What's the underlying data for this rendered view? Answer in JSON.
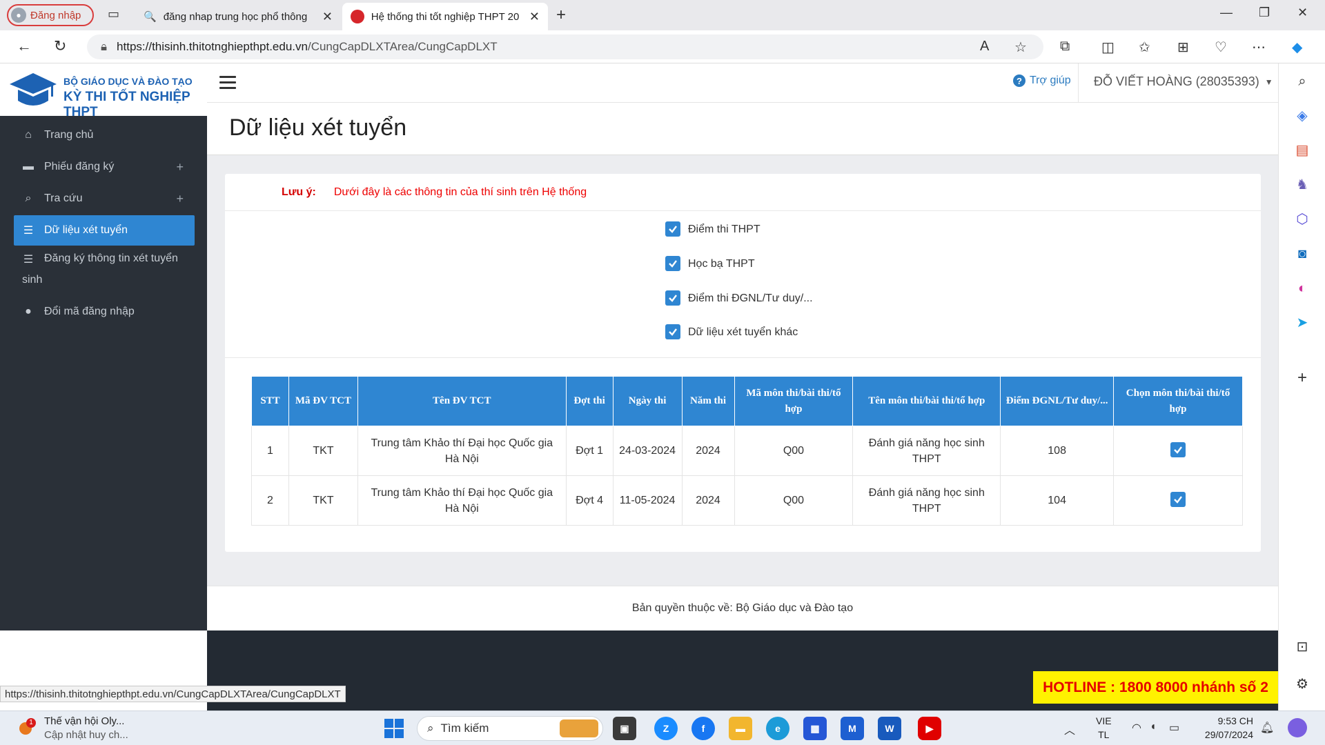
{
  "browser": {
    "profile_label": "Đăng nhập",
    "tabs": [
      {
        "title": "đăng nhap trung học phổ thông"
      },
      {
        "title": "Hệ thống thi tốt nghiệp THPT 20"
      }
    ],
    "url_host": "https://thisinh.thitotnghiepthpt.edu.vn",
    "url_path": "/CungCapDLXTArea/CungCapDLXT",
    "status_url": "https://thisinh.thitotnghiepthpt.edu.vn/CungCapDLXTArea/CungCapDLXT"
  },
  "header": {
    "logo_line1": "BỘ GIÁO DỤC VÀ ĐÀO TẠO",
    "logo_line2": "KỲ THI TỐT NGHIỆP THPT",
    "help_label": "Trợ giúp",
    "user_label": "ĐỖ VIẾT HOÀNG (28035393)"
  },
  "sidebar": {
    "items": [
      {
        "label": "Trang chủ",
        "icon": "home-icon"
      },
      {
        "label": "Phiếu đăng ký",
        "icon": "folder-icon"
      },
      {
        "label": "Tra cứu",
        "icon": "search-icon"
      },
      {
        "label": "Dữ liệu xét tuyển",
        "icon": "list-icon"
      },
      {
        "label": "Đăng ký thông tin xét tuyển",
        "label2": "sinh",
        "icon": "list-icon"
      },
      {
        "label": "Đổi mã đăng nhập",
        "icon": "user-icon"
      }
    ]
  },
  "main": {
    "title": "Dữ liệu xét tuyển",
    "note_label": "Lưu ý:",
    "note_text": "Dưới đây là các thông tin của thí sinh trên Hệ thống",
    "checkboxes": [
      {
        "label": "Điểm thi THPT",
        "checked": true
      },
      {
        "label": "Học bạ THPT",
        "checked": true
      },
      {
        "label": "Điểm thi ĐGNL/Tư duy/...",
        "checked": true
      },
      {
        "label": "Dữ liệu xét tuyển khác",
        "checked": true
      }
    ],
    "table": {
      "headers": [
        "STT",
        "Mã ĐV TCT",
        "Tên ĐV TCT",
        "Đợt thi",
        "Ngày thi",
        "Năm thi",
        "Mã môn thi/bài thi/tổ hợp",
        "Tên môn thi/bài thi/tổ hợp",
        "Điểm ĐGNL/Tư duy/...",
        "Chọn môn thi/bài thi/tổ hợp"
      ],
      "rows": [
        [
          "1",
          "TKT",
          "Trung tâm Khảo thí Đại học Quốc gia Hà Nội",
          "Đợt 1",
          "24-03-2024",
          "2024",
          "Q00",
          "Đánh giá năng học sinh THPT",
          "108"
        ],
        [
          "2",
          "TKT",
          "Trung tâm Khảo thí Đại học Quốc gia Hà Nội",
          "Đợt 4",
          "11-05-2024",
          "2024",
          "Q00",
          "Đánh giá năng học sinh THPT",
          "104"
        ]
      ]
    },
    "footer": "Bản quyền thuộc về: Bộ Giáo dục và Đào tạo",
    "hotline": "HOTLINE : 1800 8000 nhánh số 2"
  },
  "taskbar": {
    "news_title": "Thế vận hội Oly...",
    "news_sub": "Cập nhật huy ch...",
    "news_badge": "1",
    "search_placeholder": "Tìm kiếm",
    "lang1": "VIE",
    "lang2": "TL",
    "time": "9:53 CH",
    "date": "29/07/2024"
  },
  "colors": {
    "accent": "#2f86d2",
    "sidebar": "#2a3038",
    "note": "#e00000",
    "hotline_bg": "#fff200"
  }
}
